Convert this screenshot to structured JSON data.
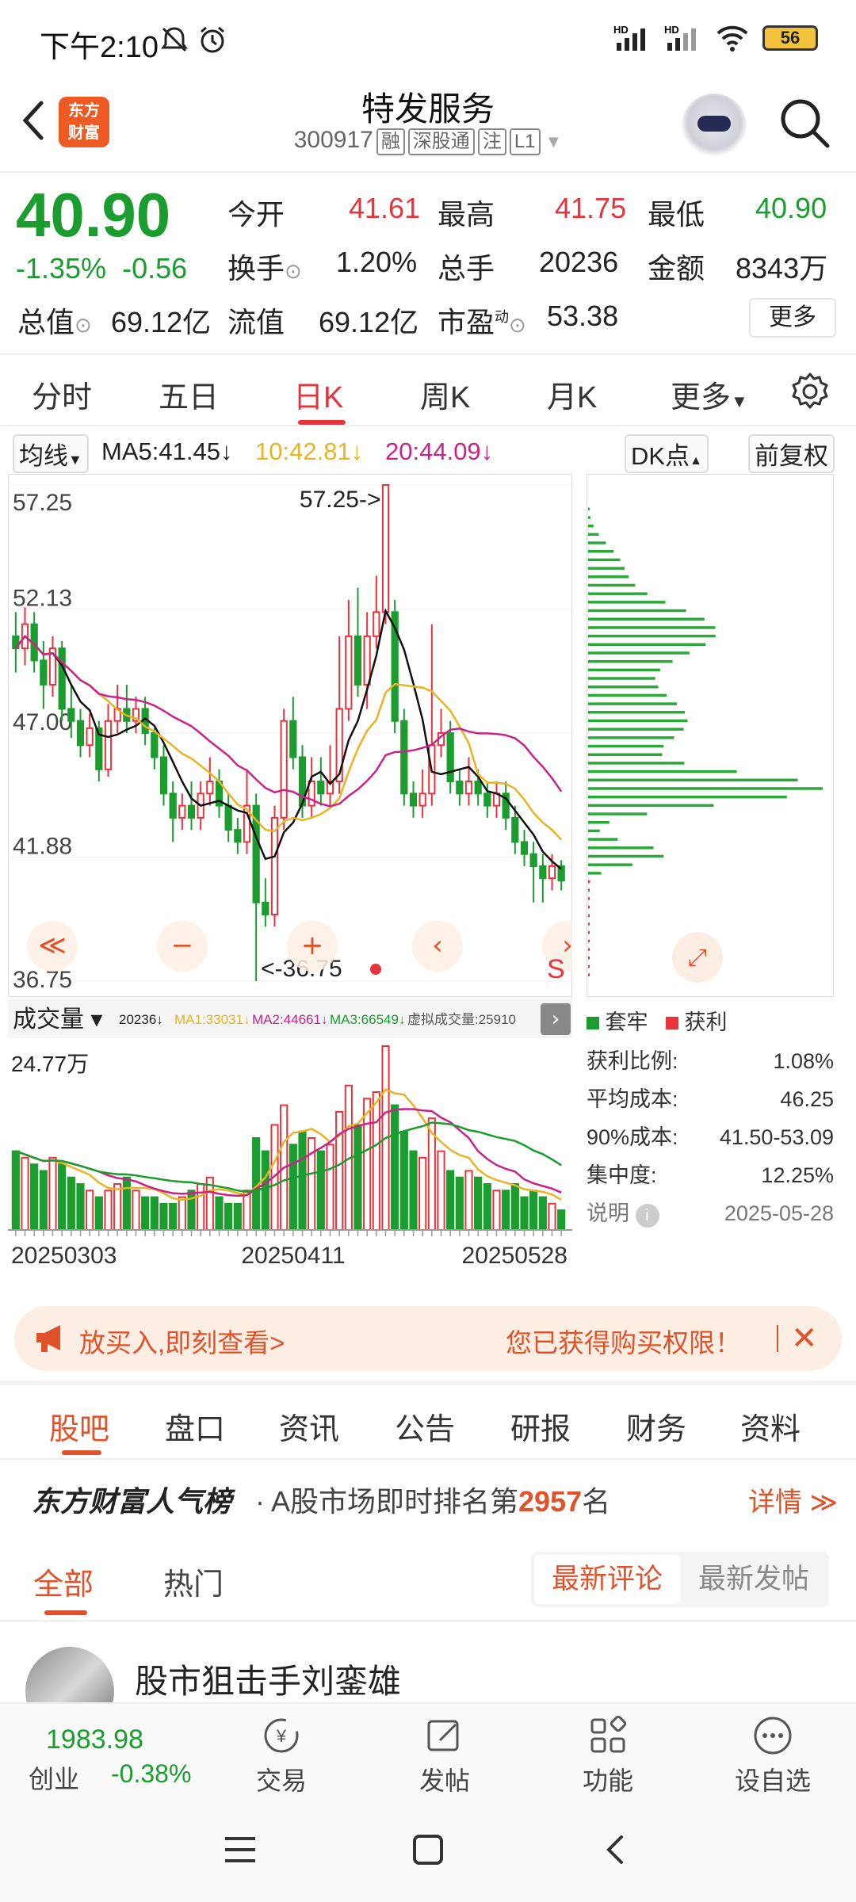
{
  "status": {
    "time": "下午2:10",
    "battery": "56",
    "hd1": "HD",
    "hd2": "HD"
  },
  "header": {
    "name": "特发服务",
    "code": "300917",
    "tags": [
      "融",
      "深股通",
      "注",
      "L1"
    ],
    "logo": "东方\n财富"
  },
  "quote": {
    "price": "40.90",
    "change_pct": "-1.35%",
    "change": "-0.56",
    "open_label": "今开",
    "open": "41.61",
    "high_label": "最高",
    "high": "41.75",
    "low_label": "最低",
    "low": "40.90",
    "turnover_label": "换手",
    "turnover": "1.20%",
    "volume_label": "总手",
    "volume": "20236",
    "amount_label": "金额",
    "amount": "8343万",
    "mktcap_label": "总值",
    "mktcap": "69.12亿",
    "float_label": "流值",
    "float": "69.12亿",
    "pe_label": "市盈",
    "pe_sup": "动",
    "pe": "53.38",
    "more": "更多"
  },
  "tabs": [
    "分时",
    "五日",
    "日K",
    "周K",
    "月K",
    "更多"
  ],
  "ma": {
    "select": "均线",
    "ma5": "MA5:41.45",
    "ma10": "10:42.81",
    "ma20": "20:44.09",
    "dk": "DK点",
    "adjust": "前复权"
  },
  "chart_data": {
    "type": "candlestick",
    "title": "",
    "y_ticks": [
      "57.25",
      "52.13",
      "47.00",
      "41.88",
      "36.75"
    ],
    "ylim": [
      36.75,
      57.25
    ],
    "high_marker": "57.25->",
    "low_marker": "<-36.75",
    "candles": [
      [
        51.0,
        50.5,
        52.0,
        49.5
      ],
      [
        50.5,
        51.5,
        52.2,
        49.8
      ],
      [
        51.5,
        50.0,
        52.0,
        49.5
      ],
      [
        50.0,
        49.0,
        50.8,
        48.0
      ],
      [
        49.0,
        50.5,
        51.0,
        48.5
      ],
      [
        50.5,
        48.0,
        50.8,
        47.5
      ],
      [
        48.0,
        47.5,
        49.0,
        46.8
      ],
      [
        47.5,
        46.5,
        48.0,
        46.0
      ],
      [
        46.5,
        47.2,
        47.8,
        46.0
      ],
      [
        47.2,
        45.5,
        47.5,
        45.0
      ],
      [
        45.5,
        47.5,
        48.2,
        45.2
      ],
      [
        47.5,
        48.0,
        49.0,
        47.0
      ],
      [
        48.0,
        47.5,
        49.0,
        47.0
      ],
      [
        47.5,
        48.0,
        48.5,
        47.0
      ],
      [
        48.0,
        47.0,
        48.5,
        46.5
      ],
      [
        47.0,
        46.0,
        47.2,
        45.5
      ],
      [
        46.0,
        44.5,
        46.5,
        44.0
      ],
      [
        44.5,
        43.5,
        45.0,
        42.5
      ],
      [
        43.5,
        44.0,
        44.5,
        43.0
      ],
      [
        44.0,
        43.5,
        45.0,
        43.0
      ],
      [
        43.5,
        44.5,
        45.0,
        43.0
      ],
      [
        44.5,
        45.0,
        46.0,
        44.0
      ],
      [
        45.0,
        44.0,
        45.5,
        43.5
      ],
      [
        44.0,
        43.0,
        44.5,
        42.5
      ],
      [
        43.0,
        42.5,
        43.5,
        42.0
      ],
      [
        42.5,
        44.0,
        45.5,
        42.0
      ],
      [
        44.0,
        40.0,
        44.5,
        36.75
      ],
      [
        40.0,
        39.5,
        41.0,
        39.0
      ],
      [
        39.5,
        43.5,
        44.0,
        39.0
      ],
      [
        43.5,
        47.5,
        48.0,
        43.0
      ],
      [
        47.5,
        46.0,
        48.5,
        45.5
      ],
      [
        46.0,
        44.0,
        46.5,
        43.5
      ],
      [
        44.0,
        45.0,
        46.0,
        43.5
      ],
      [
        45.0,
        44.5,
        46.0,
        44.0
      ],
      [
        44.5,
        45.0,
        46.5,
        44.0
      ],
      [
        45.0,
        48.0,
        51.0,
        44.5
      ],
      [
        48.0,
        51.0,
        52.5,
        47.5
      ],
      [
        51.0,
        49.0,
        53.0,
        48.5
      ],
      [
        49.0,
        51.0,
        52.0,
        48.0
      ],
      [
        51.0,
        52.0,
        53.5,
        50.5
      ],
      [
        52.0,
        57.25,
        57.25,
        51.5
      ],
      [
        52.0,
        47.5,
        52.5,
        47.0
      ],
      [
        47.5,
        44.5,
        48.0,
        44.0
      ],
      [
        44.5,
        44.0,
        45.0,
        43.5
      ],
      [
        44.0,
        44.5,
        45.5,
        43.5
      ],
      [
        44.5,
        46.5,
        51.5,
        44.0
      ],
      [
        46.5,
        47.0,
        48.0,
        46.0
      ],
      [
        47.0,
        45.0,
        47.5,
        44.5
      ],
      [
        45.0,
        44.5,
        45.5,
        44.0
      ],
      [
        44.5,
        45.0,
        46.0,
        44.0
      ],
      [
        45.0,
        44.5,
        45.5,
        44.0
      ],
      [
        44.5,
        44.0,
        45.0,
        43.5
      ],
      [
        44.0,
        44.5,
        45.0,
        43.5
      ],
      [
        44.5,
        43.5,
        45.0,
        43.0
      ],
      [
        43.5,
        42.5,
        44.0,
        42.0
      ],
      [
        42.5,
        42.0,
        43.0,
        41.5
      ],
      [
        42.0,
        41.5,
        42.5,
        40.0
      ],
      [
        41.5,
        41.0,
        42.0,
        40.0
      ],
      [
        41.0,
        41.5,
        42.0,
        40.5
      ],
      [
        41.5,
        40.9,
        41.75,
        40.5
      ]
    ],
    "chip_label_hold": "套牢",
    "chip_label_profit": "获利",
    "volume_select": "成交量",
    "volume_legend": {
      "vol": "20236↓",
      "ma1": "MA1:33031↓",
      "ma2": "MA2:44661↓",
      "ma3": "MA3:66549↓",
      "virtual": "虚拟成交量:25910"
    },
    "volume_top": "24.77万",
    "volume_dates": [
      "20250303",
      "20250411",
      "20250528"
    ]
  },
  "chip_stats": [
    {
      "label": "获利比例:",
      "value": "1.08%"
    },
    {
      "label": "平均成本:",
      "value": "46.25"
    },
    {
      "label": "90%成本:",
      "value": "41.50-53.09"
    },
    {
      "label": "集中度:",
      "value": "12.25%"
    },
    {
      "label": "说明",
      "value": "2025-05-28"
    }
  ],
  "banner": {
    "left": "放买入,即刻查看>",
    "right": "您已获得购买权限！"
  },
  "sections": [
    "股吧",
    "盘口",
    "资讯",
    "公告",
    "研报",
    "财务",
    "资料"
  ],
  "rank": {
    "brand": "东方财富人气榜",
    "pre": "· A股市场即时排名第",
    "num": "2957",
    "post": "名",
    "more": "详情 ≫"
  },
  "sub_tabs": {
    "all": "全部",
    "hot": "热门",
    "seg_a": "最新评论",
    "seg_b": "最新发帖"
  },
  "post": {
    "author": "股市狙击手刘銮雄"
  },
  "bottom_nav": {
    "index_value": "1983.98",
    "index_name": "创业",
    "index_change": "-0.38%",
    "items": [
      "交易",
      "发帖",
      "功能",
      "设自选"
    ]
  }
}
